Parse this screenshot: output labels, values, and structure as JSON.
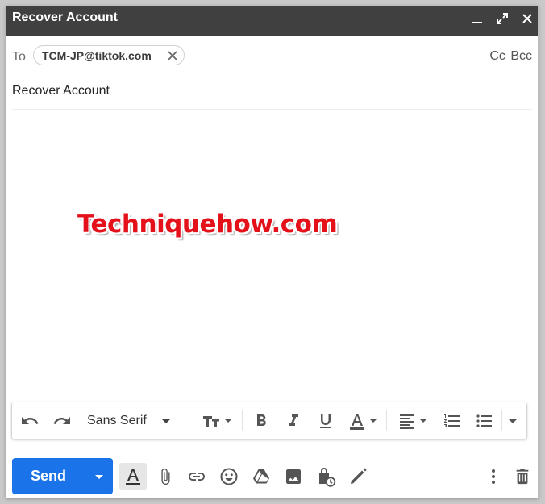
{
  "window": {
    "title": "Recover Account"
  },
  "recipients": {
    "to_label": "To",
    "chips": [
      "TCM-JP@tiktok.com"
    ],
    "cc_bcc": "Cc Bcc"
  },
  "subject": "Recover Account",
  "body": {
    "watermark": "Techniquehow.com"
  },
  "format_toolbar": {
    "font_family": "Sans Serif",
    "icons": [
      "undo-icon",
      "redo-icon",
      "font-size-icon",
      "bold-icon",
      "italic-icon",
      "underline-icon",
      "text-color-icon",
      "align-icon",
      "numbered-list-icon",
      "bulleted-list-icon",
      "more-formatting-icon"
    ]
  },
  "bottom_toolbar": {
    "send_label": "Send",
    "icons": [
      "formatting-options-icon",
      "attach-icon",
      "link-icon",
      "emoji-icon",
      "drive-icon",
      "photo-icon",
      "confidential-icon",
      "signature-icon",
      "more-options-icon",
      "discard-icon"
    ]
  },
  "colors": {
    "titlebar": "#404040",
    "send": "#1a73e8",
    "watermark": "#e4111b"
  }
}
